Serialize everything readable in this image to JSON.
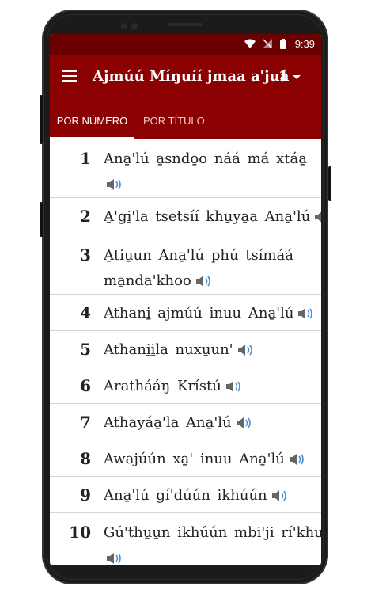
{
  "status": {
    "time": "9:39",
    "icons": [
      "wifi-icon",
      "signal-off-icon",
      "battery-icon"
    ]
  },
  "appbar": {
    "title": "Ajmúú Míŋuíí jmaa a'juá",
    "number": "1"
  },
  "tabs": {
    "by_number": "POR NÚMERO",
    "by_title": "POR TÍTULO"
  },
  "hymns": [
    {
      "number": "1",
      "line1": "Ana̱'lú a̱sndo̱o náá má xtáa̱",
      "line2": ""
    },
    {
      "number": "2",
      "line1": "A̱'gi̱'la tsetsíí khu̱ya̱a Ana̱'lú",
      "line2": ""
    },
    {
      "number": "3",
      "line1": "A̱tiu̱un Ana̱'lú phú tsímáá",
      "line2": "ma̱nda'khoo"
    },
    {
      "number": "4",
      "line1": "Athani̱ ajmúú inuu Ana̱'lú",
      "line2": ""
    },
    {
      "number": "5",
      "line1": "Athani̱i̱la nuxu̱un'",
      "line2": ""
    },
    {
      "number": "6",
      "line1": "Arathááŋ Krístú",
      "line2": ""
    },
    {
      "number": "7",
      "line1": "Athayáa̱'la Ana̱'lú",
      "line2": ""
    },
    {
      "number": "8",
      "line1": "Awajúún xa̱' inuu Ana̱'lú",
      "line2": ""
    },
    {
      "number": "9",
      "line1": "Ana̱'lú gí'dúún ikhúún",
      "line2": ""
    },
    {
      "number": "10",
      "line1": "Gú'thu̱u̱n ikhúún mbi'ji rí'khui̱",
      "line2": ""
    }
  ]
}
